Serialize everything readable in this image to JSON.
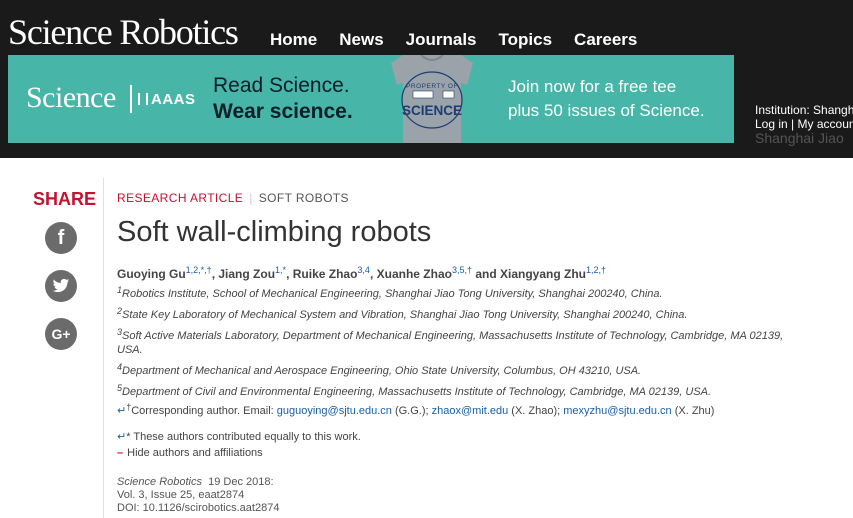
{
  "header": {
    "brand": "Science Robotics",
    "nav": [
      "Home",
      "News",
      "Journals",
      "Topics",
      "Careers"
    ]
  },
  "banner": {
    "logo": "Science",
    "aaas": "AAAS",
    "read_line1": "Read Science.",
    "read_line2": "Wear science.",
    "tee_text_top": "PROPERTY OF",
    "tee_text_main": "SCIENCE",
    "join_line1": "Join now for a free tee",
    "join_line2": "plus 50 issues of Science."
  },
  "institution": {
    "label": "Institution: Shanghai",
    "login": "Log in",
    "separator": "|",
    "my_account": "My account",
    "name": "Shanghai Jiao"
  },
  "share": {
    "label": "SHARE",
    "facebook_glyph": "f",
    "googleplus_glyph": "G+"
  },
  "article": {
    "category_primary": "RESEARCH ARTICLE",
    "category_secondary": "SOFT ROBOTS",
    "title": "Soft wall-climbing robots",
    "authors": [
      {
        "name": "Guoying Gu",
        "sup": "1,2,*,†",
        "sep": ", "
      },
      {
        "name": "Jiang Zou",
        "sup": "1,*",
        "sep": ", "
      },
      {
        "name": "Ruike Zhao",
        "sup": "3,4",
        "sep": ", "
      },
      {
        "name": "Xuanhe Zhao",
        "sup": "3,5,†",
        "sep": " and "
      },
      {
        "name": "Xiangyang Zhu",
        "sup": "1,2,†",
        "sep": ""
      }
    ],
    "affiliations": [
      {
        "num": "1",
        "text": "Robotics Institute, School of Mechanical Engineering, Shanghai Jiao Tong University, Shanghai 200240, China."
      },
      {
        "num": "2",
        "text": "State Key Laboratory of Mechanical System and Vibration, Shanghai Jiao Tong University, Shanghai 200240, China."
      },
      {
        "num": "3",
        "text": "Soft Active Materials Laboratory, Department of Mechanical Engineering, Massachusetts Institute of Technology, Cambridge, MA 02139, USA."
      },
      {
        "num": "4",
        "text": "Department of Mechanical and Aerospace Engineering, Ohio State University, Columbus, OH 43210, USA."
      },
      {
        "num": "5",
        "text": "Department of Civil and Environmental Engineering, Massachusetts Institute of Technology, Cambridge, MA 02139, USA."
      }
    ],
    "corresponding": {
      "prefix": "Corresponding author. Email: ",
      "email1": "guguoying@sjtu.edu.cn",
      "who1": " (G.G.); ",
      "email2": "zhaox@mit.edu",
      "who2": " (X. Zhao); ",
      "email3": "mexyzhu@sjtu.edu.cn",
      "who3": " (X. Zhu)"
    },
    "equal_contrib": "* These authors contributed equally to this work.",
    "hide_link": "Hide authors and affiliations",
    "citation": {
      "journal": "Science Robotics",
      "date": "19 Dec 2018:",
      "volume": "Vol. 3, Issue 25, eaat2874",
      "doi": "DOI: 10.1126/scirobotics.aat2874"
    }
  }
}
